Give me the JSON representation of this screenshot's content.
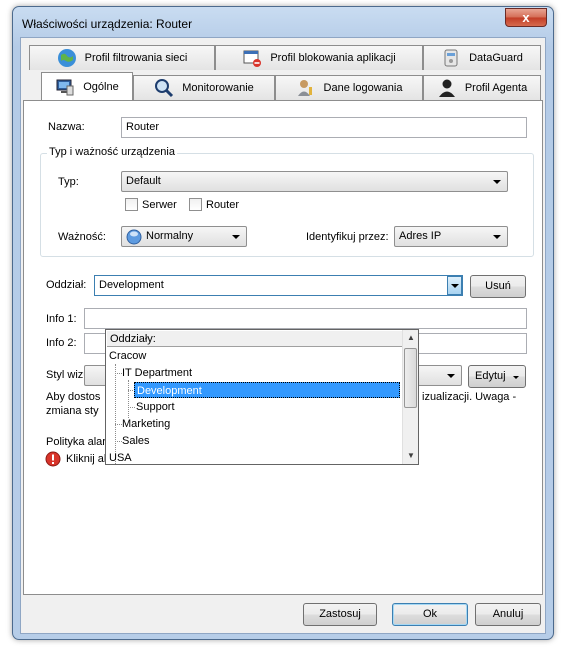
{
  "window": {
    "title": "Właściwości urządzenia: Router",
    "close_glyph": "x"
  },
  "tabs_row1": [
    {
      "label": "Profil filtrowania sieci",
      "icon": "globe-icon"
    },
    {
      "label": "Profil blokowania aplikacji",
      "icon": "window-block-icon"
    },
    {
      "label": "DataGuard",
      "icon": "dataguard-icon"
    }
  ],
  "tabs_row2": [
    {
      "label": "Ogólne",
      "icon": "computer-icon",
      "active": true
    },
    {
      "label": "Monitorowanie",
      "icon": "magnifier-icon"
    },
    {
      "label": "Dane logowania",
      "icon": "user-key-icon"
    },
    {
      "label": "Profil Agenta",
      "icon": "person-icon"
    }
  ],
  "general": {
    "name_label": "Nazwa:",
    "name_value": "Router",
    "type_group_title": "Typ i ważność urządzenia",
    "type_label": "Typ:",
    "type_value": "Default",
    "checkbox_server": "Serwer",
    "checkbox_router": "Router",
    "importance_label": "Ważność:",
    "importance_value": "Normalny",
    "identify_label": "Identyfikuj przez:",
    "identify_value": "Adres IP",
    "branch_label": "Oddział:",
    "branch_value": "Development",
    "remove_button": "Usuń",
    "info1_label": "Info 1:",
    "info2_label": "Info 2:",
    "style_label": "Styl wizua",
    "edit_button": "Edytuj",
    "note_line1_start": "Aby dostos",
    "note_line1_end": "izualizacji. Uwaga -",
    "note_line2_start": "zmiana sty",
    "alarm_label": "Polityka alarmowania:",
    "alarm_link": "Kliknij aby zarządzać alarmami urządzenia"
  },
  "branch_dropdown": {
    "header": "Oddziały:",
    "items": [
      {
        "label": "Cracow",
        "level": 0
      },
      {
        "label": "IT Department",
        "level": 1
      },
      {
        "label": "Development",
        "level": 2,
        "selected": true
      },
      {
        "label": "Support",
        "level": 2
      },
      {
        "label": "Marketing",
        "level": 1
      },
      {
        "label": "Sales",
        "level": 1
      },
      {
        "label": "USA",
        "level": 0
      }
    ]
  },
  "footer": {
    "apply": "Zastosuj",
    "ok": "Ok",
    "cancel": "Anuluj"
  },
  "colors": {
    "selection": "#3399ff",
    "titlebar": "#b9d1ea",
    "close": "#c7432e"
  }
}
